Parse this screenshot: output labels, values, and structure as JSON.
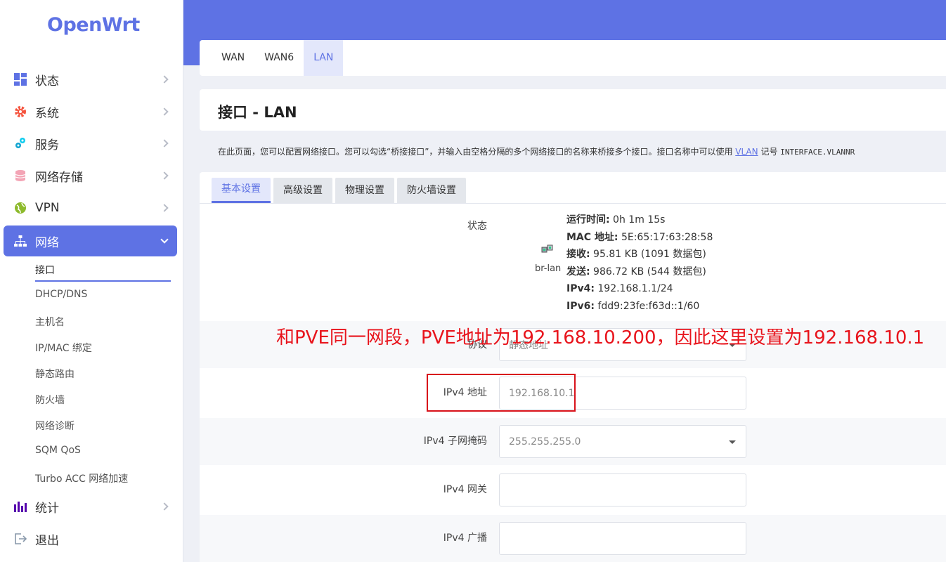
{
  "brand": {
    "logo": "OpenWrt",
    "accent": "#5e72e4"
  },
  "sidebar": {
    "items": [
      {
        "label": "状态",
        "icon": "dashboard-icon"
      },
      {
        "label": "系统",
        "icon": "gear-icon"
      },
      {
        "label": "服务",
        "icon": "services-icon"
      },
      {
        "label": "网络存储",
        "icon": "database-icon"
      },
      {
        "label": "VPN",
        "icon": "globe-icon"
      },
      {
        "label": "网络",
        "icon": "network-icon"
      },
      {
        "label": "统计",
        "icon": "bar-chart-icon"
      },
      {
        "label": "退出",
        "icon": "logout-icon"
      }
    ],
    "network_submenu": [
      "接口",
      "DHCP/DNS",
      "主机名",
      "IP/MAC 绑定",
      "静态路由",
      "防火墙",
      "网络诊断",
      "SQM QoS",
      "Turbo ACC 网络加速"
    ]
  },
  "top_tabs": [
    "WAN",
    "WAN6",
    "LAN"
  ],
  "page": {
    "title": "接口 - LAN",
    "description_prefix": "在此页面，您可以配置网络接口。您可以勾选“桥接接口”，并输入由空格分隔的多个网络接口的名称来桥接多个接口。接口名称中可以使用 ",
    "description_link": "VLAN",
    "description_mid": " 记号 ",
    "description_code": "INTERFACE.VLANNR"
  },
  "sub_tabs": [
    "基本设置",
    "高级设置",
    "物理设置",
    "防火墙设置"
  ],
  "status": {
    "label": "状态",
    "interface_name": "br-lan",
    "uptime_key": "运行时间:",
    "uptime_val": " 0h 1m 15s",
    "mac_key": "MAC 地址:",
    "mac_val": " 5E:65:17:63:28:58",
    "rx_key": "接收:",
    "rx_val": " 95.81 KB (1091 数据包)",
    "tx_key": "发送:",
    "tx_val": " 986.72 KB (544 数据包)",
    "ipv4_key": "IPv4:",
    "ipv4_val": " 192.168.1.1/24",
    "ipv6_key": "IPv6:",
    "ipv6_val": " fdd9:23fe:f63d::1/60"
  },
  "form": {
    "protocol_label": "协议",
    "protocol_value": "静态地址",
    "ipv4_addr_label": "IPv4 地址",
    "ipv4_addr_value": "192.168.10.1",
    "netmask_label": "IPv4 子网掩码",
    "netmask_value": "255.255.255.0",
    "gateway_label": "IPv4 网关",
    "gateway_value": "",
    "broadcast_label": "IPv4 广播",
    "broadcast_value": ""
  },
  "annotation": "和PVE同一网段，PVE地址为192.168.10.200，因此这里设置为192.168.10.1"
}
